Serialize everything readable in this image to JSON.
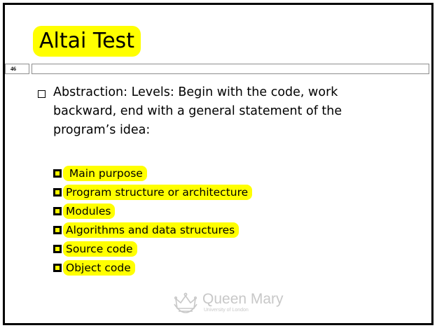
{
  "slide": {
    "title": "Altai Test",
    "page_number": "46",
    "main_point": "Abstraction: Levels: Begin with the code, work backward, end with a general statement of the program’s idea:",
    "sub_items": [
      " Main purpose",
      "Program structure or architecture",
      "Modules",
      "Algorithms and data structures",
      "Source code",
      "Object code"
    ],
    "logo": {
      "name": "Queen Mary",
      "subtitle": "University of London",
      "icon": "crown-icon"
    }
  },
  "colors": {
    "highlight": "#ffff00",
    "frame": "#000000",
    "rule": "#8c8c8c",
    "logo": "#c8c8c8"
  }
}
